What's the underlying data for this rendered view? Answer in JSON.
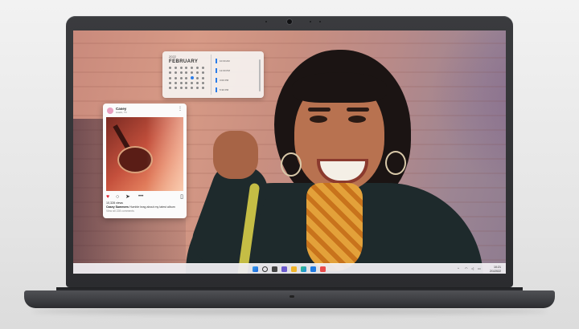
{
  "calendar_widget": {
    "year": "2022",
    "month": "FEBRUARY",
    "events": [
      {
        "label": "10:00 AM"
      },
      {
        "label": "12:00 PM"
      },
      {
        "label": "3:00 PM"
      },
      {
        "label": "5:30 PM"
      }
    ]
  },
  "social_post": {
    "username": "Casey",
    "location": "Austin, TX",
    "views": "10,328 views",
    "caption_user": "Casey Summers",
    "caption_text": " Humble brag about my latest album",
    "comments_link": "View all 228 comments"
  },
  "taskbar": {
    "tray_caret": "^",
    "time": "10:21",
    "date": "2/1/2022"
  },
  "colors": {
    "accent": "#2b7de9",
    "like": "#e0242f"
  },
  "icons": {
    "like": "heart-icon",
    "comment": "comment-icon",
    "share": "share-icon",
    "more": "more-icon",
    "save": "bookmark-icon"
  }
}
